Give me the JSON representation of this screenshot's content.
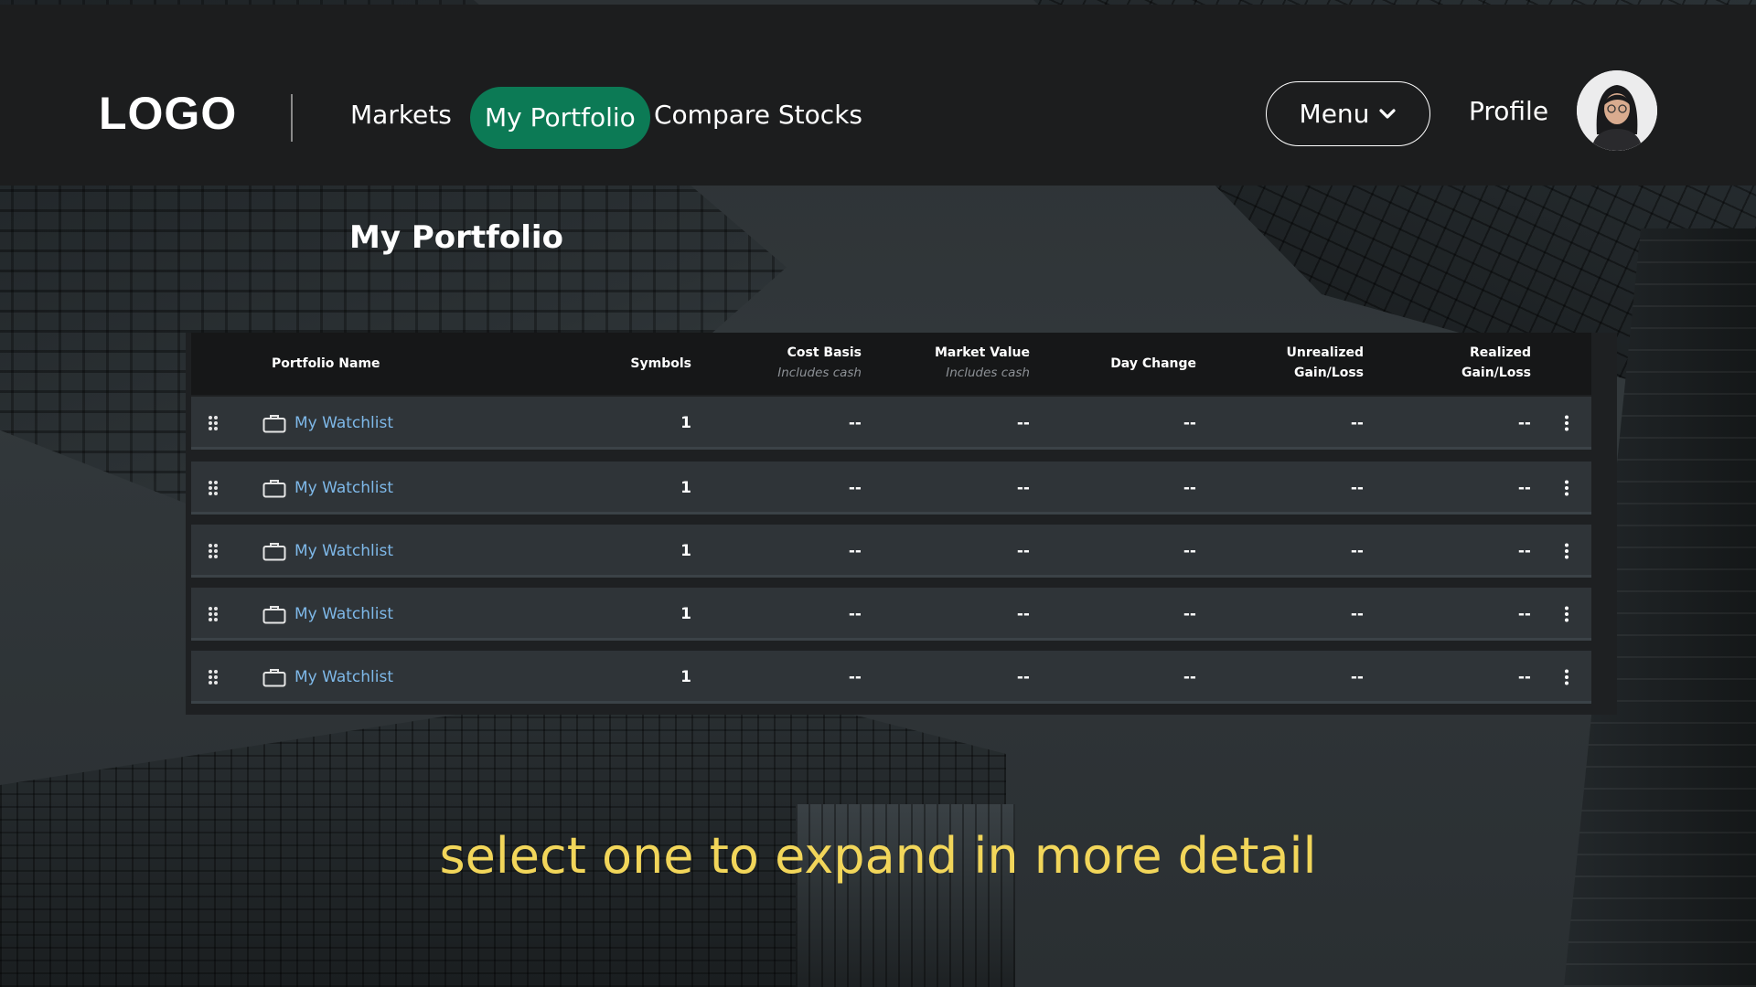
{
  "header": {
    "logo": "LOGO",
    "nav": {
      "markets": "Markets",
      "my_portfolio": "My Portfolio",
      "compare_stocks": "Compare Stocks"
    },
    "menu_label": "Menu",
    "profile_label": "Profile"
  },
  "page": {
    "title": "My Portfolio"
  },
  "table": {
    "columns": {
      "portfolio_name": "Portfolio Name",
      "symbols": "Symbols",
      "cost_basis": "Cost Basis",
      "cost_basis_sub": "Includes cash",
      "market_value": "Market Value",
      "market_value_sub": "Includes cash",
      "day_change": "Day Change",
      "unrealized_1": "Unrealized",
      "unrealized_2": "Gain/Loss",
      "realized_1": "Realized",
      "realized_2": "Gain/Loss"
    },
    "rows": [
      {
        "name": "My Watchlist",
        "symbols": "1",
        "cost_basis": "--",
        "market_value": "--",
        "day_change": "--",
        "unrealized": "--",
        "realized": "--"
      },
      {
        "name": "My Watchlist",
        "symbols": "1",
        "cost_basis": "--",
        "market_value": "--",
        "day_change": "--",
        "unrealized": "--",
        "realized": "--"
      },
      {
        "name": "My Watchlist",
        "symbols": "1",
        "cost_basis": "--",
        "market_value": "--",
        "day_change": "--",
        "unrealized": "--",
        "realized": "--"
      },
      {
        "name": "My Watchlist",
        "symbols": "1",
        "cost_basis": "--",
        "market_value": "--",
        "day_change": "--",
        "unrealized": "--",
        "realized": "--"
      },
      {
        "name": "My Watchlist",
        "symbols": "1",
        "cost_basis": "--",
        "market_value": "--",
        "day_change": "--",
        "unrealized": "--",
        "realized": "--"
      }
    ]
  },
  "caption": "select one to expand in more detail",
  "icons": {
    "drag": "drag-handle-icon",
    "portfolio": "briefcase-icon",
    "more": "more-vertical-icon",
    "chevron": "chevron-down-icon"
  },
  "colors": {
    "accent": "#0c7a55",
    "link": "#7eb8e8",
    "caption": "#f2d65a",
    "header_bg": "#1c1d1e",
    "row_bg": "#2f3438"
  }
}
